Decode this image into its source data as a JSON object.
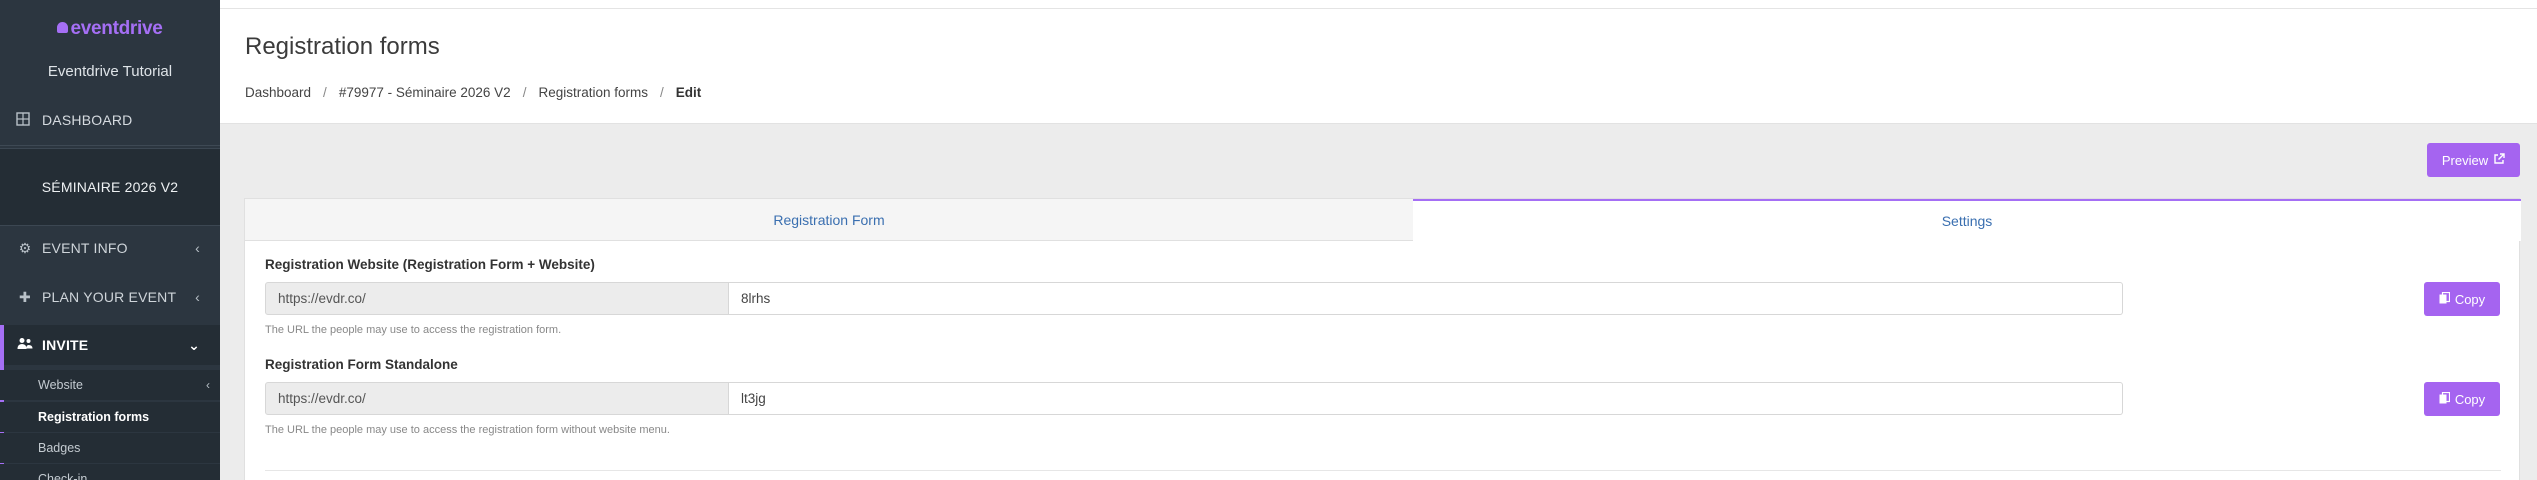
{
  "sidebar": {
    "logo": "eventdrive",
    "org": "Eventdrive Tutorial",
    "dashboard": "DASHBOARD",
    "event_name": "SÉMINAIRE 2026 V2",
    "items": [
      {
        "label": "EVENT INFO",
        "icon": "gears-icon"
      },
      {
        "label": "PLAN YOUR EVENT",
        "icon": "puzzle-icon"
      },
      {
        "label": "INVITE",
        "icon": "users-icon"
      }
    ],
    "subitems": [
      {
        "label": "Website"
      },
      {
        "label": "Registration forms"
      },
      {
        "label": "Badges"
      },
      {
        "label": "Check-in"
      }
    ]
  },
  "header": {
    "title": "Registration forms",
    "breadcrumb": [
      "Dashboard",
      "#79977 - Séminaire 2026 V2",
      "Registration forms",
      "Edit"
    ]
  },
  "preview_label": "Preview",
  "tabs": [
    "Registration Form",
    "Settings"
  ],
  "fields": [
    {
      "label": "Registration Website (Registration Form + Website)",
      "prefix": "https://evdr.co/",
      "value": "8lrhs",
      "help": "The URL the people may use to access the registration form.",
      "copy_label": "Copy"
    },
    {
      "label": "Registration Form Standalone",
      "prefix": "https://evdr.co/",
      "value": "lt3jg",
      "help": "The URL the people may use to access the registration form without website menu.",
      "copy_label": "Copy"
    }
  ],
  "colors": {
    "accent": "#a564f0",
    "sidebar_bg": "#2c3640",
    "tab_text": "#3a6fb0"
  }
}
